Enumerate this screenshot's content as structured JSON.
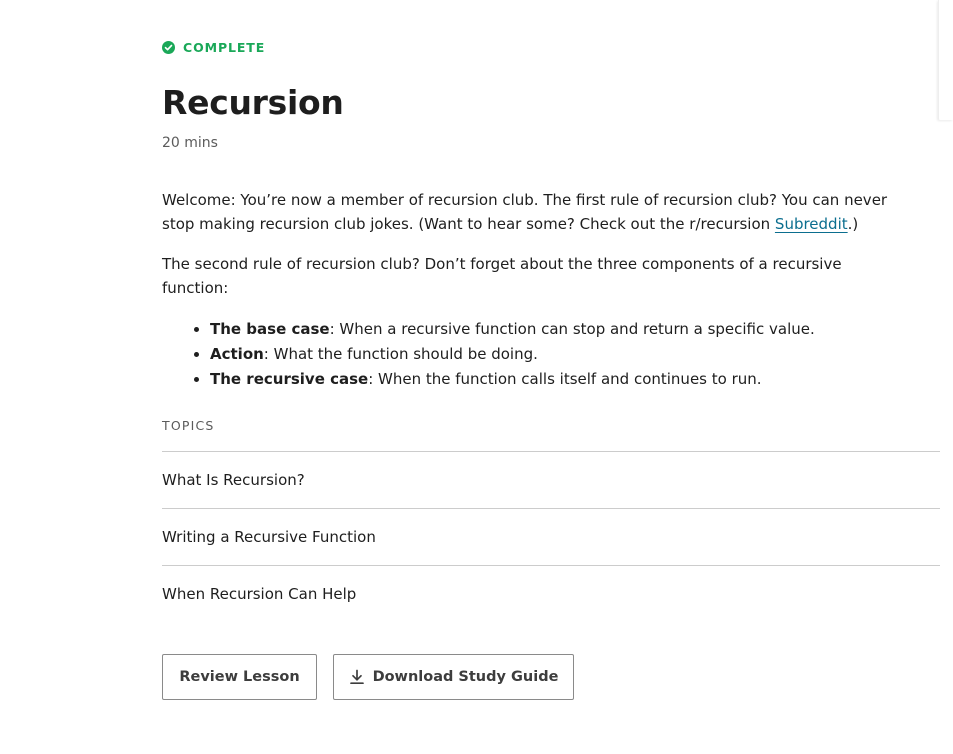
{
  "status": {
    "icon": "check-circle-icon",
    "label": "COMPLETE",
    "color": "#1aa858"
  },
  "lesson": {
    "title": "Recursion",
    "duration": "20 mins"
  },
  "description": {
    "intro_before_link": "Welcome: You’re now a member of recursion club. The first rule of recursion club? You can never stop making recursion club jokes. (Want to hear some? Check out the r/recursion ",
    "link_label": "Subreddit",
    "intro_after_link": ".)",
    "second_rule": "The second rule of recursion club? Don’t forget about the three components of a recursive function:",
    "components": [
      {
        "term": "The base case",
        "text": ": When a recursive function can stop and return a specific value."
      },
      {
        "term": "Action",
        "text": ": What the function should be doing."
      },
      {
        "term": "The recursive case",
        "text": ": When the function calls itself and continues to run."
      }
    ]
  },
  "topics": {
    "heading": "TOPICS",
    "items": [
      {
        "label": "What Is Recursion?"
      },
      {
        "label": "Writing a Recursive Function"
      },
      {
        "label": "When Recursion Can Help"
      }
    ]
  },
  "actions": {
    "review_label": "Review Lesson",
    "download_label": "Download Study Guide",
    "download_icon": "download-icon"
  },
  "colors": {
    "accent_green": "#1aa858",
    "link_teal": "#0b6e8f",
    "text_primary": "#1e1e1e",
    "text_secondary": "#5b5b5b"
  }
}
